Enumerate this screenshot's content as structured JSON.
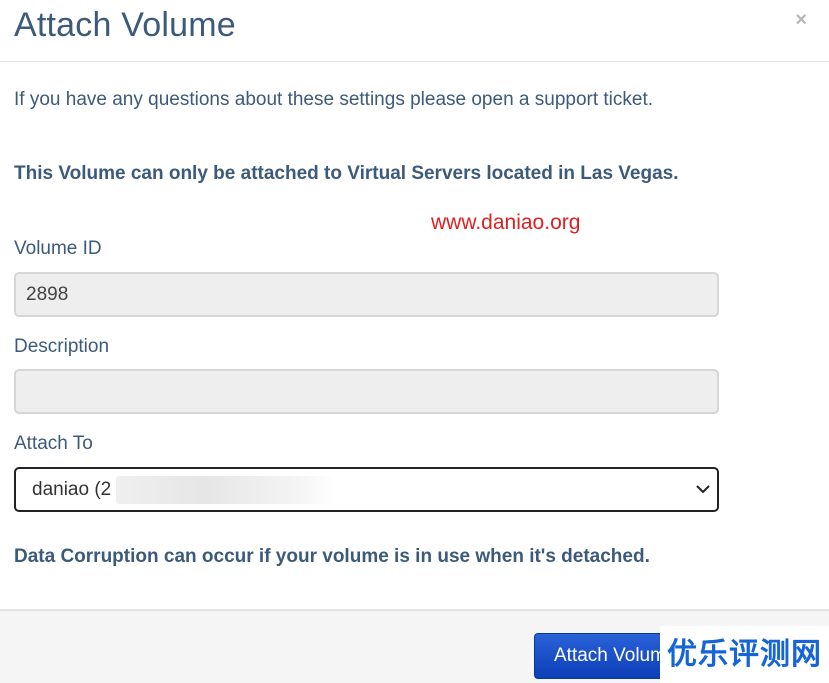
{
  "dialog": {
    "title": "Attach Volume",
    "close_label": "×",
    "intro": "If you have any questions about these settings please open a support ticket.",
    "notice": "This Volume can only be attached to Virtual Servers located in Las Vegas.",
    "watermark_url": "www.daniao.org",
    "fields": {
      "volume_id": {
        "label": "Volume ID",
        "value": "2898"
      },
      "description": {
        "label": "Description",
        "value": ""
      },
      "attach_to": {
        "label": "Attach To",
        "value": "daniao (2"
      }
    },
    "warning": "Data Corruption can occur if your volume is in use when it's detached.",
    "footer": {
      "attach_button_label": "Attach Volume"
    },
    "watermark_brand": "优乐评测网"
  },
  "colors": {
    "title": "#3c5a7a",
    "button": "#1a4fcc",
    "watermark_url": "#e02020",
    "watermark_brand": "#1565d8"
  },
  "icons": {
    "close": "close-icon",
    "select_arrow": "chevron-down-icon"
  }
}
